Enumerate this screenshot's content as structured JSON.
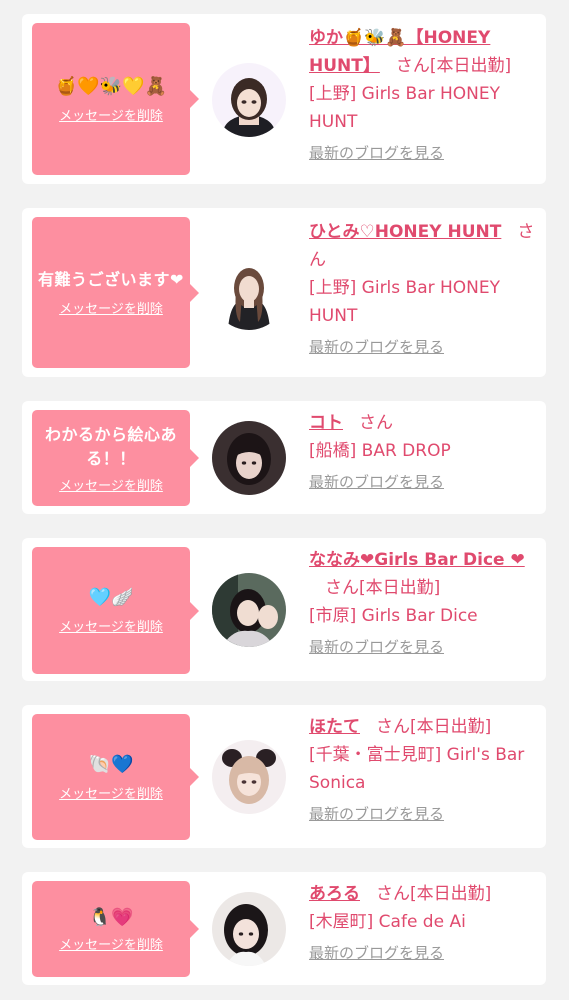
{
  "actions": {
    "delete_message": "メッセージを削除",
    "view_blog": "最新のブログを見る",
    "honorific": "さん"
  },
  "cards": [
    {
      "message": "🍯🧡🐝💛🧸",
      "name": "ゆか🍯🐝🧸【HONEY HUNT】",
      "status": "[本日出勤]",
      "shop": "[上野] Girls Bar HONEY HUNT"
    },
    {
      "message": "有難うございます❤",
      "name": "ひとみ♡HONEY HUNT",
      "status": "",
      "shop": "[上野] Girls Bar HONEY HUNT"
    },
    {
      "message": "わかるから絵心ある！！",
      "name": "コト",
      "status": "",
      "shop": "[船橋] BAR DROP"
    },
    {
      "message": "🩵🪽",
      "name": "ななみ❤Girls Bar Dice ❤",
      "status": "[本日出勤]",
      "shop": "[市原] Girls Bar Dice"
    },
    {
      "message": "🐚💙",
      "name": "ほたて",
      "status": "[本日出勤]",
      "shop": "[千葉・富士見町] Girl's Bar Sonica"
    },
    {
      "message": "🐧💗",
      "name": "あろる",
      "status": "[本日出勤]",
      "shop": "[木屋町] Cafe de Ai"
    }
  ]
}
